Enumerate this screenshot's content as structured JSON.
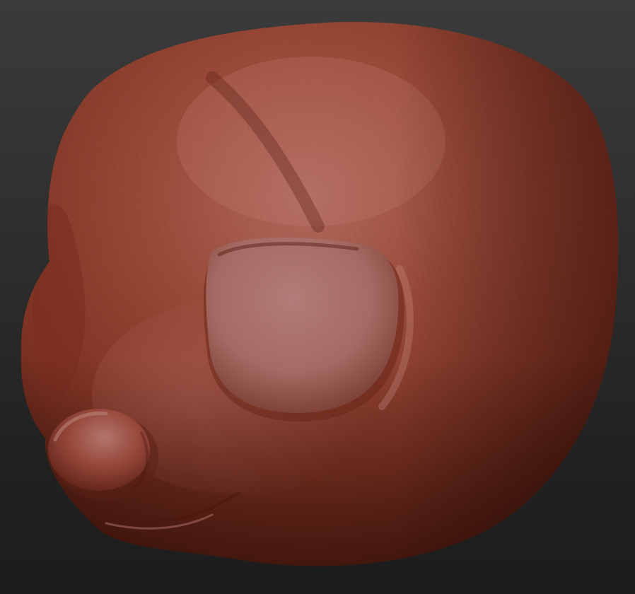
{
  "viewport": {
    "subject": "sculpted-creature-head",
    "colors": {
      "background_top": "#3b3b3b",
      "background_bottom": "#1c1c1c",
      "clay_base": "#8e3b29",
      "clay_highlight": "#b3675c",
      "clay_shadow": "#4a1a10"
    }
  }
}
